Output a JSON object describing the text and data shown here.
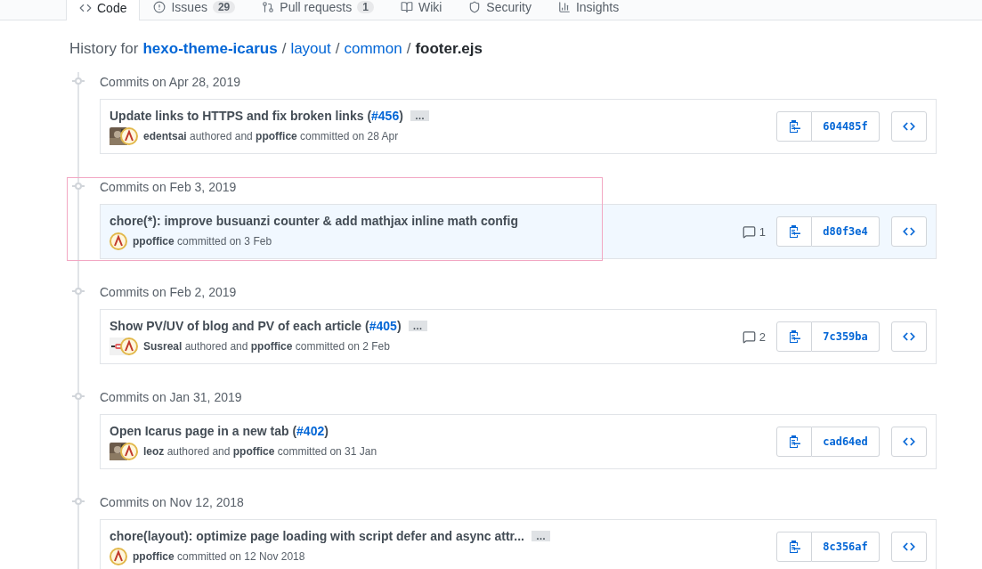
{
  "tabs": [
    {
      "label": "Code",
      "selected": true
    },
    {
      "label": "Issues",
      "count": "29",
      "selected": false
    },
    {
      "label": "Pull requests",
      "count": "1",
      "selected": false
    },
    {
      "label": "Wiki",
      "selected": false
    },
    {
      "label": "Security",
      "selected": false
    },
    {
      "label": "Insights",
      "selected": false
    }
  ],
  "breadcrumb": {
    "prefix": "History for",
    "parts": [
      {
        "label": "hexo-theme-icarus",
        "kind": "repo"
      },
      {
        "label": "layout",
        "kind": "dir"
      },
      {
        "label": "common",
        "kind": "dir"
      },
      {
        "label": "footer.ejs",
        "kind": "file"
      }
    ],
    "separator": "/"
  },
  "groups": [
    {
      "heading": "Commits on Apr 28, 2019",
      "outlined": false,
      "commits": [
        {
          "title": "Update links to HTTPS and fix broken links (",
          "pr": "#456",
          "title_end": ")",
          "expand_label": "…",
          "avatars": [
            {
              "kind": "photo"
            },
            {
              "kind": "logo"
            }
          ],
          "meta": "**edentsai** authored and **ppoffice** committed on 28 Apr",
          "sha": "604485f",
          "hovered": false
        }
      ]
    },
    {
      "heading": "Commits on Feb 3, 2019",
      "outlined": true,
      "commits": [
        {
          "title": "chore(*): improve busuanzi counter & add mathjax inline math config",
          "avatars": [
            {
              "kind": "logo"
            }
          ],
          "meta": "**ppoffice** committed on 3 Feb",
          "comments": "1",
          "sha": "d80f3e4",
          "hovered": true
        }
      ]
    },
    {
      "heading": "Commits on Feb 2, 2019",
      "outlined": false,
      "commits": [
        {
          "title": "Show PV/UV of blog and PV of each article (",
          "pr": "#405",
          "title_end": ")",
          "expand_label": "…",
          "avatars": [
            {
              "kind": "badge"
            },
            {
              "kind": "logo"
            }
          ],
          "meta": "**Susreal** authored and **ppoffice** committed on 2 Feb",
          "comments": "2",
          "sha": "7c359ba",
          "hovered": false
        }
      ]
    },
    {
      "heading": "Commits on Jan 31, 2019",
      "outlined": false,
      "commits": [
        {
          "title": "Open Icarus page in a new tab (",
          "pr": "#402",
          "title_end": ")",
          "avatars": [
            {
              "kind": "photo"
            },
            {
              "kind": "logo"
            }
          ],
          "meta": "**leoz** authored and **ppoffice** committed on 31 Jan",
          "sha": "cad64ed",
          "hovered": false
        }
      ]
    },
    {
      "heading": "Commits on Nov 12, 2018",
      "outlined": false,
      "commits": [
        {
          "title": "chore(layout): optimize page loading with script defer and async attr...",
          "expand_label": "…",
          "avatars": [
            {
              "kind": "logo"
            }
          ],
          "meta": "**ppoffice** committed on 12 Nov 2018",
          "sha": "8c356af",
          "hovered": false
        }
      ]
    }
  ]
}
